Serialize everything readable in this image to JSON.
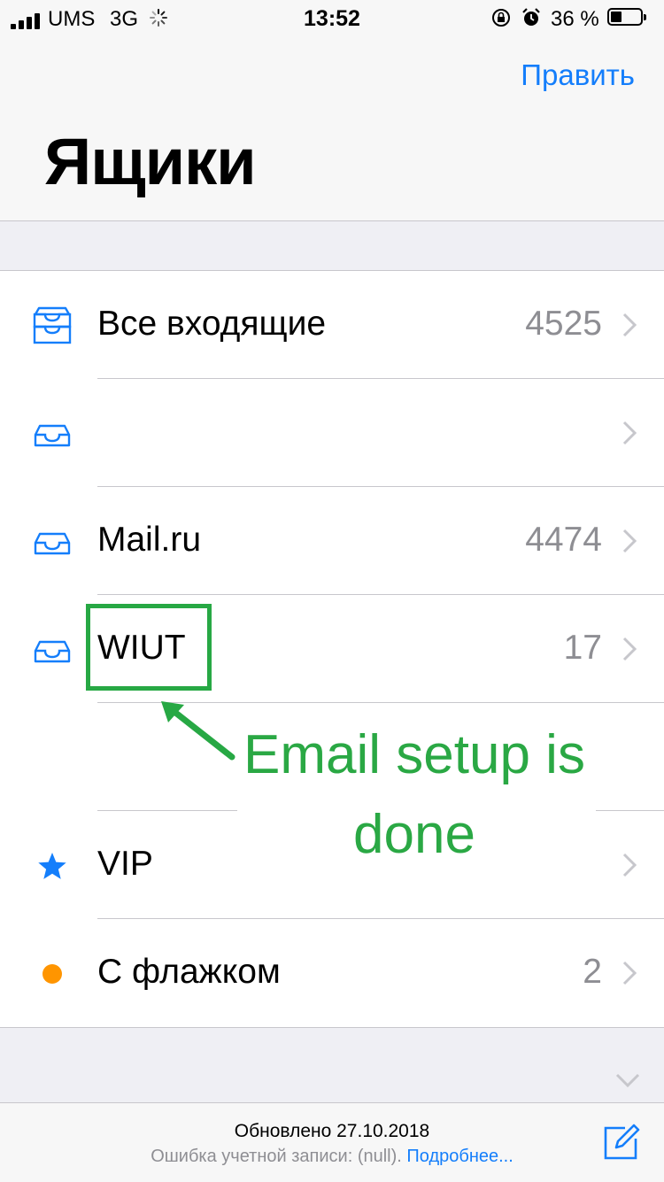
{
  "status_bar": {
    "carrier": "UMS",
    "network": "3G",
    "time": "13:52",
    "battery_percent": "36 %"
  },
  "header": {
    "edit_label": "Править",
    "title": "Ящики"
  },
  "mailboxes": [
    {
      "icon": "inbox-tray-icon",
      "label": "Все входящие",
      "count": "4525"
    },
    {
      "icon": "inbox-tray-icon",
      "label": "",
      "count": ""
    },
    {
      "icon": "inbox-tray-icon",
      "label": "Mail.ru",
      "count": "4474"
    },
    {
      "icon": "inbox-tray-icon",
      "label": "WIUT",
      "count": "17"
    },
    {
      "icon": "empty",
      "label": "",
      "count": ""
    },
    {
      "icon": "star-icon",
      "label": "VIP",
      "count": ""
    },
    {
      "icon": "flag-dot-icon",
      "label": "С флажком",
      "count": "2"
    }
  ],
  "annotation": {
    "text_line1": "Email setup is",
    "text_line2": "done",
    "color": "#2aa844"
  },
  "footer": {
    "updated": "Обновлено 27.10.2018",
    "error_text": "Ошибка учетной записи: (null).",
    "more_link": "Подробнее..."
  },
  "colors": {
    "accent": "#147efb",
    "flag": "#ff9500",
    "annotation": "#27a844"
  }
}
